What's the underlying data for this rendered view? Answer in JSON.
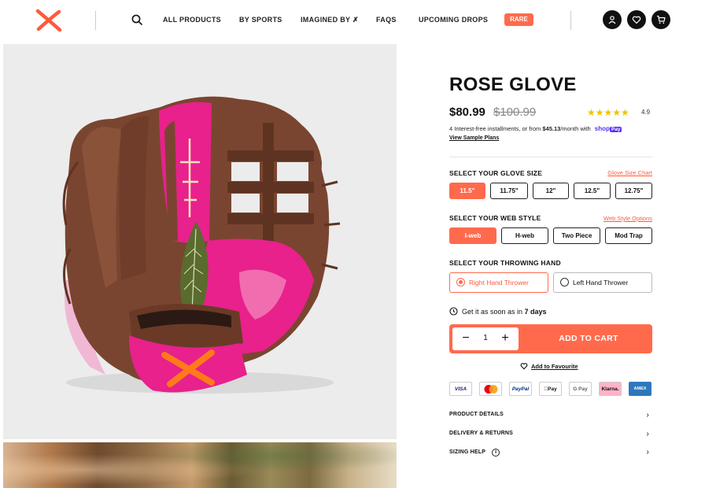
{
  "header": {
    "nav": [
      "ALL PRODUCTS",
      "BY SPORTS",
      "IMAGINED BY ✗",
      "FAQS",
      "UPCOMING DROPS"
    ],
    "rare_label": "RARE"
  },
  "product": {
    "title": "ROSE GLOVE",
    "price": "$80.99",
    "old_price": "$100.99",
    "stars": "★★★★★",
    "rating": "4.9",
    "installments_prefix": "4 Interest-free installments, or from ",
    "installments_amount": "$45.13",
    "installments_suffix": "/month with",
    "shop_pay": "shop",
    "shop_pay_badge": "Pay",
    "sample_plans": "View Sample Plans"
  },
  "glove_size": {
    "label": "SELECT YOUR GLOVE SIZE",
    "link": "Glove Size Chart",
    "options": [
      "11.5\"",
      "11.75\"",
      "12\"",
      "12.5\"",
      "12.75\""
    ],
    "selected": 0
  },
  "web_style": {
    "label": "SELECT YOUR WEB STYLE",
    "link": "Web Style Options",
    "options": [
      "I-web",
      "H-web",
      "Two Piece",
      "Mod Trap"
    ],
    "selected": 0
  },
  "throwing_hand": {
    "label": "SELECT YOUR THROWING HAND",
    "options": [
      "Right Hand Thrower",
      "Left Hand Thrower"
    ],
    "selected": 0
  },
  "delivery": {
    "prefix": "Get it as soon as in ",
    "days": "7 days"
  },
  "cart": {
    "quantity": "1",
    "minus": "−",
    "plus": "+",
    "add_label": "ADD TO CART",
    "favourite": "Add to Favourite"
  },
  "payments": [
    "VISA",
    "",
    "PayPal",
    "Pay",
    "G Pay",
    "Klarna.",
    "AMEX"
  ],
  "accordion": [
    "PRODUCT DETAILS",
    "DELIVERY & RETURNS",
    "SIZING HELP"
  ],
  "colors": {
    "accent": "#ff6a4d",
    "glove_brown": "#7a4530",
    "glove_pink": "#e8218c",
    "shop_pay": "#5a31f4"
  }
}
